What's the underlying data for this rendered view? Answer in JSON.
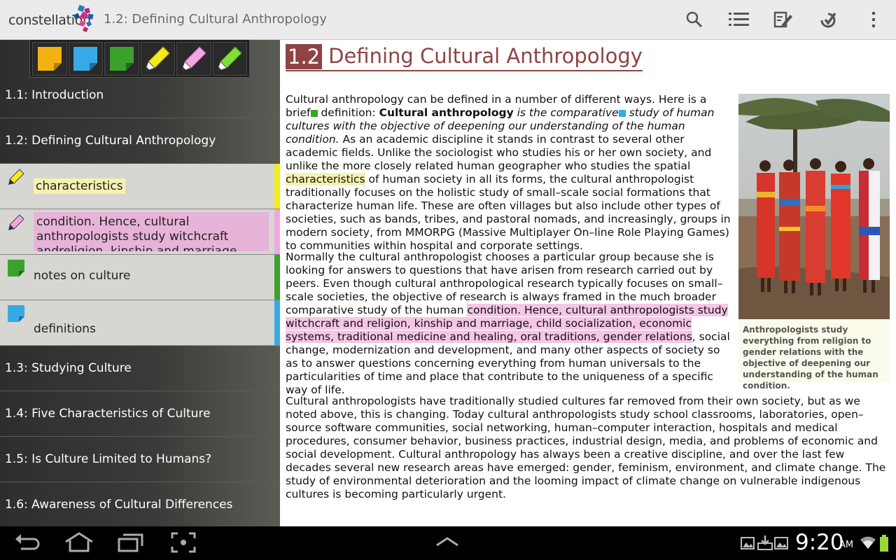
{
  "app": {
    "logo_text": "constellation",
    "title": "1.2: Defining Cultural Anthropology"
  },
  "actions": [
    "search-icon",
    "list-icon",
    "edit-icon",
    "sync-icon",
    "overflow-icon"
  ],
  "tools": [
    "yellow-note",
    "blue-note",
    "green-note",
    "yellow-highlighter",
    "pink-highlighter",
    "green-highlighter"
  ],
  "sidebar": {
    "items": [
      {
        "label": "1.1: Introduction"
      },
      {
        "label": "1.2: Defining Cultural Anthropology"
      },
      {
        "label": "1.3: Studying Culture"
      },
      {
        "label": "1.4: Five Characteristics of Culture"
      },
      {
        "label": "1.5: Is Culture Limited to Humans?"
      },
      {
        "label": "1.6: Awareness of Cultural Differences"
      }
    ],
    "annotations": [
      {
        "label": "characteristics",
        "color": "#f3ec17",
        "kind": "yellow-highlight"
      },
      {
        "label": "condition. Hence, cultural anthropologists study witchcraft andreligion, kinship and marriage, child",
        "color": "#f3a6e3",
        "kind": "pink-highlight"
      },
      {
        "label": "notes on culture",
        "color": "#3aa12c",
        "kind": "green-note"
      },
      {
        "label": "definitions",
        "color": "#37a9e6",
        "kind": "blue-note"
      }
    ]
  },
  "content": {
    "section_num": "1.2",
    "section_title": "Defining Cultural Anthropology",
    "p1": {
      "a": "Cultural anthropology can be defined in a number of different ways. Here is a brief",
      "b": " definition: ",
      "term": "Cultural anthropology",
      "def1": " is the comparative",
      "def2": " study of human cultures with the objective of deepening our understanding of the human condition.",
      "c": " As an academic discipline it stands in contrast to several other academic fields. Unlike the sociologist who studies his or her own society, and unlike the more closely related human geographer who studies the spatial ",
      "hl": "characteristics",
      "d": " of human society in all its forms, the cultural anthropologist traditionally focuses on the holistic study of small–scale social formations that characterize human life. These are often villages but also include other types of societies, such as bands, tribes, and pastoral nomads, and increasingly, groups in modern society, from MMORPG (Massive Multiplayer On–line Role Playing Games) to communities within hospital and corporate settings."
    },
    "p2": {
      "a": "Normally the cultural anthropologist chooses a particular group because she is looking for answers to questions that have arisen from research carried out by peers. Even though cultural anthropological research typically focuses on small–scale societies, the objective of research is always framed in the much broader comparative study of the human ",
      "hl": "condition. Hence, cultural anthropologists study witchcraft and religion, kinship and marriage, child socialization, economic systems, traditional medicine and healing, oral traditions, gender relations",
      "b": ", social change, modernization and development, and many other aspects of society so as to answer questions concerning everything from human universals to the particularities of time and place that contribute to the uniqueness of a specific way of life."
    },
    "p3": "Cultural anthropologists have traditionally studied cultures far removed from their own society, but as we noted above, this is changing. Today cultural anthropologists study school classrooms, laboratories, open–source software communities, social networking, human–computer interaction, hospitals and medical procedures, consumer behavior, business practices, industrial design, media, and problems of economic and social development. Cultural anthropology has always been a creative discipline, and over the last few decades several new research areas have emerged: gender, feminism, environment, and climate change. The study of environmental deterioration and the looming impact of climate change on vulnerable indigenous cultures is becoming particularly urgent.",
    "figure_caption": "Anthropologists study everything from religion to gender relations with the objective of deepening our understanding of the human condition."
  },
  "status": {
    "time": "9:20",
    "ampm": "AM"
  },
  "colors": {
    "accent": "#8f4343",
    "yellow_hl": "#f6f2b0",
    "pink_hl": "#f5c6e6"
  }
}
